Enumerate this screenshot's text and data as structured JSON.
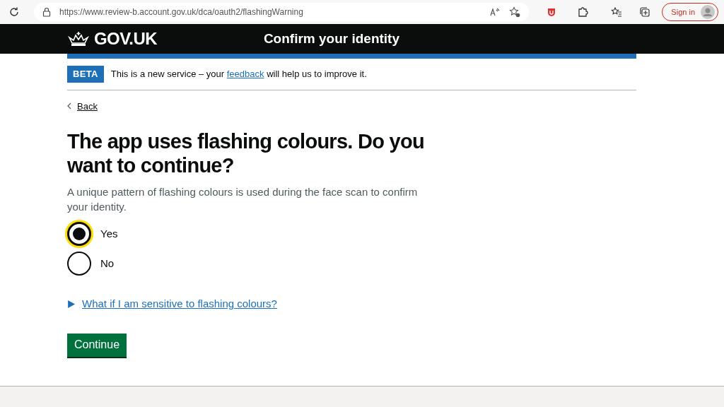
{
  "browser": {
    "url": "https://www.review-b.account.gov.uk/dca/oauth2/flashingWarning",
    "sign_in": "Sign in"
  },
  "header": {
    "logo": "GOV.UK",
    "service": "Confirm your identity"
  },
  "phase_banner": {
    "tag": "BETA",
    "before": "This is a new service – your",
    "link": "feedback",
    "after": "will help us to improve it."
  },
  "back_link": "Back",
  "heading": "The app uses flashing colours. Do you want to continue?",
  "hint": "A unique pattern of flashing colours is used during the face scan to confirm your identity.",
  "options": [
    {
      "label": "Yes",
      "selected": true
    },
    {
      "label": "No",
      "selected": false
    }
  ],
  "details": {
    "summary": "What if I am sensitive to flashing colours?",
    "expanded": false
  },
  "continue_button": "Continue"
}
